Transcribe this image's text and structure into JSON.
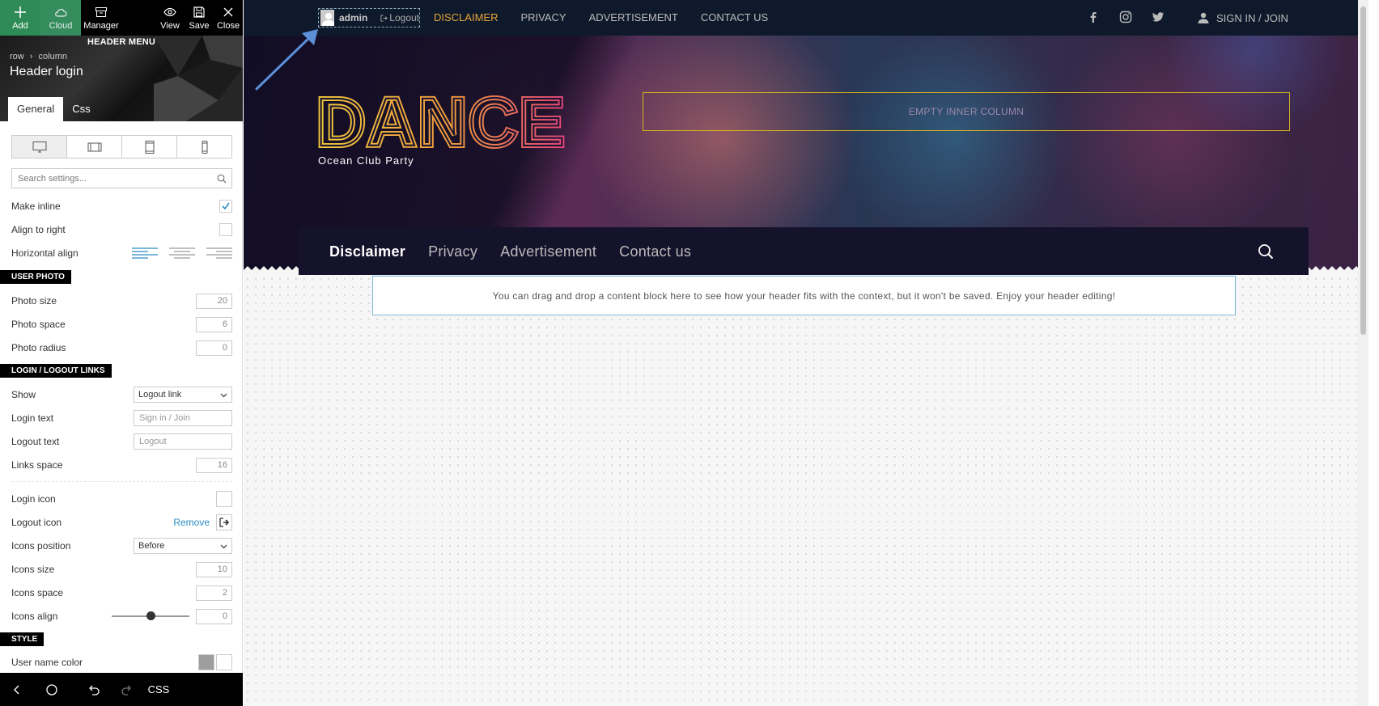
{
  "toolbar": {
    "add": "Add",
    "cloud": "Cloud",
    "manager": "Manager",
    "view": "View",
    "save": "Save",
    "close": "Close"
  },
  "panel": {
    "section_label": "HEADER MENU",
    "breadcrumb_row": "row",
    "breadcrumb_sep": "›",
    "breadcrumb_column": "column",
    "title": "Header login",
    "tabs": [
      "General",
      "Css"
    ],
    "search_placeholder": "Search settings...",
    "make_inline": "Make inline",
    "align_right": "Align to right",
    "horizontal_align": "Horizontal align",
    "sections": {
      "user_photo": "USER PHOTO",
      "login_links": "LOGIN / LOGOUT LINKS",
      "style": "STYLE"
    },
    "photo_size": {
      "label": "Photo size",
      "value": "20"
    },
    "photo_space": {
      "label": "Photo space",
      "value": "6"
    },
    "photo_radius": {
      "label": "Photo radius",
      "value": "0"
    },
    "show": {
      "label": "Show",
      "value": "Logout link"
    },
    "login_text": {
      "label": "Login text",
      "placeholder": "Sign in / Join"
    },
    "logout_text": {
      "label": "Logout text",
      "placeholder": "Logout"
    },
    "links_space": {
      "label": "Links space",
      "value": "16"
    },
    "login_icon": "Login icon",
    "logout_icon": {
      "label": "Logout icon",
      "remove": "Remove"
    },
    "icons_position": {
      "label": "Icons position",
      "value": "Before"
    },
    "icons_size": {
      "label": "Icons size",
      "value": "10"
    },
    "icons_space": {
      "label": "Icons space",
      "value": "2"
    },
    "icons_align": {
      "label": "Icons align",
      "value": "0"
    },
    "user_name_color": {
      "label": "User name color",
      "color": "#9e9e9e"
    },
    "footer_css": "CSS"
  },
  "preview": {
    "login": {
      "username": "admin",
      "logout": "Logout"
    },
    "topnav": [
      "DISCLAIMER",
      "PRIVACY",
      "ADVERTISEMENT",
      "CONTACT US"
    ],
    "signin": "SIGN IN / JOIN",
    "logo_text": "DANCE",
    "tagline": "Ocean Club Party",
    "inner_column": "EMPTY INNER COLUMN",
    "mainnav": [
      "Disclaimer",
      "Privacy",
      "Advertisement",
      "Contact us"
    ],
    "drop_hint": "You can drag and drop a content block here to see how your header fits with the context, but it won't be saved. Enjoy your header editing!"
  },
  "colors": {
    "accent_green": "#2e8b57",
    "active_nav": "#e5a43a",
    "link_blue": "#2a8cc4",
    "inner_column_border": "#d4b21e"
  }
}
